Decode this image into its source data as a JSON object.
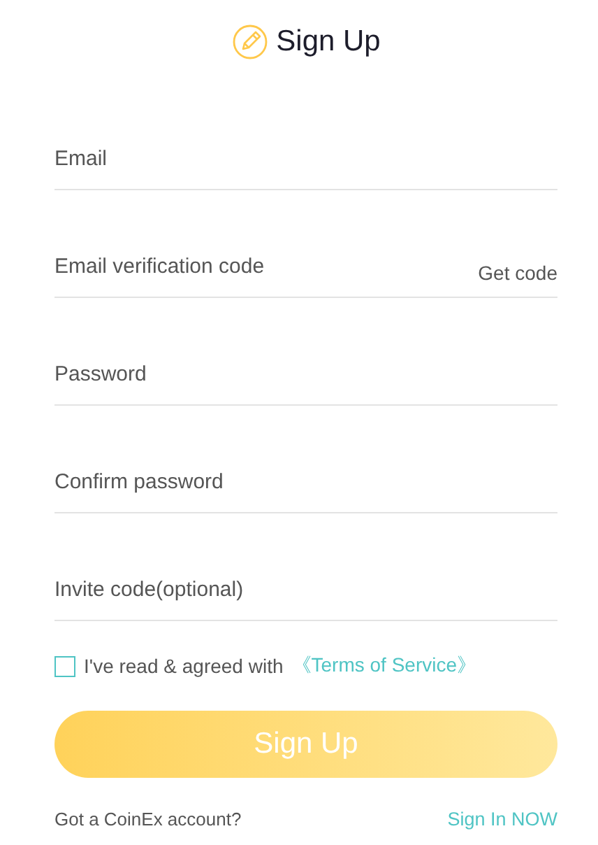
{
  "title": "Sign Up",
  "fields": [
    {
      "kind": "text",
      "placeholder": "Email"
    },
    {
      "kind": "code",
      "placeholder": "Email verification code",
      "action": "Get code"
    },
    {
      "kind": "password",
      "placeholder": "Password"
    },
    {
      "kind": "password",
      "placeholder": "Confirm password"
    },
    {
      "kind": "text",
      "placeholder": "Invite code(optional)"
    }
  ],
  "agreement": {
    "checked": false,
    "text": "I've read & agreed with",
    "link": "《Terms of Service》"
  },
  "submit": "Sign Up",
  "footer": {
    "text": "Got a CoinEx account?",
    "link": "Sign In NOW"
  }
}
